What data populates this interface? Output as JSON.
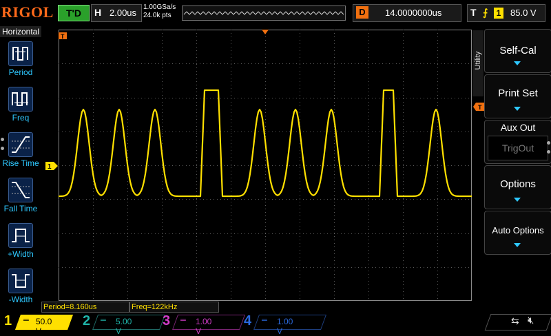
{
  "brand": {
    "logo": "RIGOL"
  },
  "status": {
    "trigger_state": "T'D"
  },
  "horizontal": {
    "letter": "H",
    "timebase": "2.00us",
    "sample_rate": "1.00GSa/s",
    "memory_depth": "24.0k pts"
  },
  "delay": {
    "letter": "D",
    "value": "14.0000000us"
  },
  "trigger": {
    "letter": "T",
    "edge_symbol": "⨍",
    "channel": "1",
    "level": "85.0 V"
  },
  "left_menu": {
    "title": "Horizontal",
    "items": [
      {
        "label": "Period",
        "icon": "period-icon"
      },
      {
        "label": "Freq",
        "icon": "frequency-icon"
      },
      {
        "label": "Rise Time",
        "icon": "rise-time-icon"
      },
      {
        "label": "Fall Time",
        "icon": "fall-time-icon"
      },
      {
        "label": "+Width",
        "icon": "positive-width-icon"
      },
      {
        "label": "-Width",
        "icon": "negative-width-icon"
      }
    ]
  },
  "right_menu": {
    "tab_label": "Utility",
    "buttons": [
      {
        "label": "Self-Cal"
      },
      {
        "label": "Print Set"
      },
      {
        "label": "Aux Out",
        "value": "TrigOut"
      },
      {
        "label": "Options"
      },
      {
        "label": "Auto Options"
      }
    ]
  },
  "measurements": {
    "period": "Period=8.160us",
    "freq": "Freq=122kHz"
  },
  "channels": [
    {
      "num": "1",
      "scale": "50.0 V",
      "color": "#ffe000",
      "active": true
    },
    {
      "num": "2",
      "scale": "5.00 V",
      "color": "#1fb3a8",
      "active": false
    },
    {
      "num": "3",
      "scale": "1.00 V",
      "color": "#d23cc8",
      "active": false
    },
    {
      "num": "4",
      "scale": "1.00 V",
      "color": "#2a6ae0",
      "active": false
    }
  ],
  "colors": {
    "ch1_trace": "#ffe000",
    "menu_accent": "#2ec8ff",
    "marker_orange": "#f07010",
    "trigger_green": "#2aa02a"
  },
  "markers": {
    "ch1_offset_label": "1",
    "trigger_level_label": "T"
  }
}
